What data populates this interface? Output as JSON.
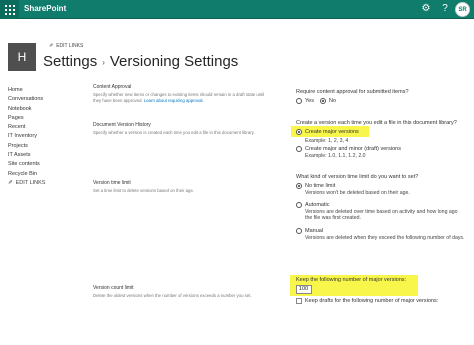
{
  "header": {
    "brand": "SharePoint",
    "avatar_initials": "SR",
    "icons": [
      "waffle-icon",
      "gear-icon",
      "help-icon"
    ]
  },
  "site": {
    "logo_letter": "H",
    "edit_links": "EDIT LINKS",
    "title": "Settings",
    "subtitle": "Versioning Settings",
    "separator": "›"
  },
  "sidebar": {
    "items": [
      {
        "label": "Home"
      },
      {
        "label": "Conversations"
      },
      {
        "label": "Notebook"
      },
      {
        "label": "Pages"
      },
      {
        "label": "Recent"
      },
      {
        "label": "IT Inventory"
      },
      {
        "label": "Projects"
      },
      {
        "label": "IT Assets"
      },
      {
        "label": "Site contents"
      },
      {
        "label": "Recycle Bin"
      }
    ],
    "edit_links": "EDIT LINKS"
  },
  "content_approval": {
    "label": "Content Approval",
    "description": "Specify whether new items or changes to existing items should remain in a draft state until they have been approved.",
    "description_link": "Learn about requiring approval.",
    "question": "Require content approval for submitted items?",
    "options": [
      "Yes",
      "No"
    ],
    "selected": "No"
  },
  "version_history": {
    "label": "Document Version History",
    "description": "Specify whether a version is created each time you edit a file in this document library.",
    "question": "Create a version each time you edit a file in this document library?",
    "option1": "Create major versions",
    "option1_example": "Example: 1, 2, 3, 4",
    "option2": "Create major and minor (draft) versions",
    "option2_example": "Example: 1.0, 1.1, 1.2, 2.0",
    "selected": "Create major versions"
  },
  "time_limit": {
    "label": "Version time limit",
    "description": "Set a time limit to delete versions based on their age.",
    "question": "What kind of version time limit do you want to set?",
    "option1": "No time limit",
    "option1_sub": "Versions won't be deleted based on their age.",
    "option2": "Automatic",
    "option2_sub": "Versions are deleted over time based on activity and how long ago the file was first created.",
    "option3": "Manual",
    "option3_sub": "Versions are deleted when they exceed the following number of days.",
    "selected": "No time limit"
  },
  "count_limit": {
    "label": "Version count limit",
    "description": "Delete the oldest versions when the number of versions exceeds a number you set.",
    "keep_label": "Keep the following number of major versions:",
    "keep_value": "100",
    "drafts_label": "Keep drafts for the following number of major versions:"
  },
  "colors": {
    "suite_bar": "#0f7c6c",
    "highlight": "#f8f64a",
    "link": "#0072c6"
  }
}
